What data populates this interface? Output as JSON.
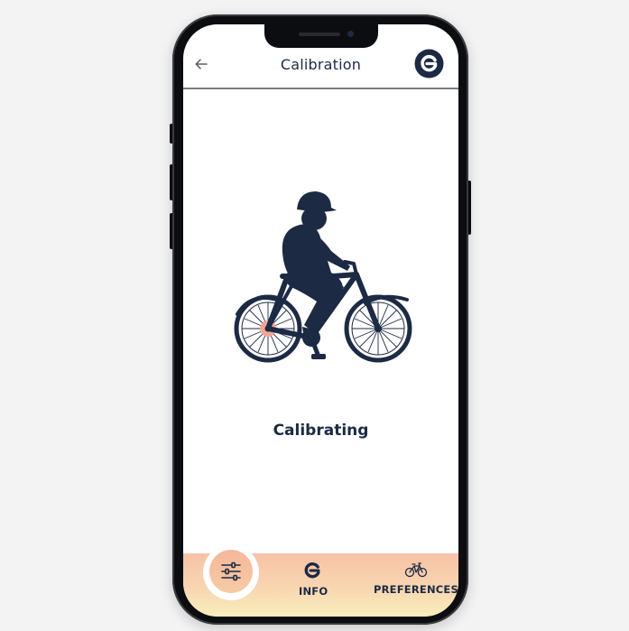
{
  "header": {
    "title": "Calibration",
    "back_icon": "arrow-left-icon",
    "brand_icon": "brand-logo-icon"
  },
  "main": {
    "illustration": "cyclist-on-bike-icon",
    "status": "Calibrating"
  },
  "bottom_nav": {
    "items": [
      {
        "label": "",
        "icon": "sliders-icon",
        "active": true
      },
      {
        "label": "INFO",
        "icon": "brand-logo-icon",
        "active": false
      },
      {
        "label": "PREFERENCES",
        "icon": "bike-icon",
        "active": false
      }
    ]
  },
  "colors": {
    "navy": "#1c2a44",
    "nav_gradient_top": "#f7c2a6",
    "nav_gradient_bottom": "#faeebd",
    "accent_coral": "#f6b79a"
  }
}
